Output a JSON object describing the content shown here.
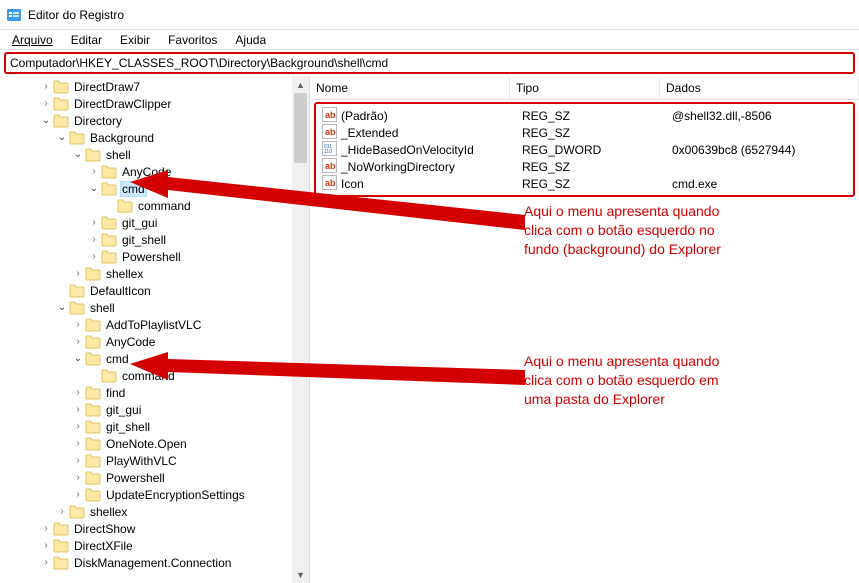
{
  "window": {
    "title": "Editor do Registro"
  },
  "menu": {
    "file": "Arquivo",
    "edit": "Editar",
    "view": "Exibir",
    "favorites": "Favoritos",
    "help": "Ajuda"
  },
  "address": {
    "path": "Computador\\HKEY_CLASSES_ROOT\\Directory\\Background\\shell\\cmd"
  },
  "columns": {
    "name": "Nome",
    "type": "Tipo",
    "data": "Dados"
  },
  "values": [
    {
      "name": "(Padrão)",
      "type": "REG_SZ",
      "data": "@shell32.dll,-8506",
      "kind": "str"
    },
    {
      "name": "_Extended",
      "type": "REG_SZ",
      "data": "",
      "kind": "str"
    },
    {
      "name": "_HideBasedOnVelocityId",
      "type": "REG_DWORD",
      "data": "0x00639bc8 (6527944)",
      "kind": "bin"
    },
    {
      "name": "_NoWorkingDirectory",
      "type": "REG_SZ",
      "data": "",
      "kind": "str"
    },
    {
      "name": "Icon",
      "type": "REG_SZ",
      "data": "cmd.exe",
      "kind": "str"
    }
  ],
  "tree": [
    {
      "lvl": 1,
      "twist": ">",
      "label": "DirectDraw7"
    },
    {
      "lvl": 1,
      "twist": ">",
      "label": "DirectDrawClipper"
    },
    {
      "lvl": 1,
      "twist": "v",
      "label": "Directory"
    },
    {
      "lvl": 2,
      "twist": "v",
      "label": "Background"
    },
    {
      "lvl": 3,
      "twist": "v",
      "label": "shell"
    },
    {
      "lvl": 4,
      "twist": ">",
      "label": "AnyCode"
    },
    {
      "lvl": 4,
      "twist": "v",
      "label": "cmd",
      "selected": true
    },
    {
      "lvl": 5,
      "twist": "",
      "label": "command"
    },
    {
      "lvl": 4,
      "twist": ">",
      "label": "git_gui"
    },
    {
      "lvl": 4,
      "twist": ">",
      "label": "git_shell"
    },
    {
      "lvl": 4,
      "twist": ">",
      "label": "Powershell"
    },
    {
      "lvl": 3,
      "twist": ">",
      "label": "shellex"
    },
    {
      "lvl": 2,
      "twist": "",
      "label": "DefaultIcon"
    },
    {
      "lvl": 2,
      "twist": "v",
      "label": "shell"
    },
    {
      "lvl": 3,
      "twist": ">",
      "label": "AddToPlaylistVLC"
    },
    {
      "lvl": 3,
      "twist": ">",
      "label": "AnyCode"
    },
    {
      "lvl": 3,
      "twist": "v",
      "label": "cmd"
    },
    {
      "lvl": 4,
      "twist": "",
      "label": "command"
    },
    {
      "lvl": 3,
      "twist": ">",
      "label": "find"
    },
    {
      "lvl": 3,
      "twist": ">",
      "label": "git_gui"
    },
    {
      "lvl": 3,
      "twist": ">",
      "label": "git_shell"
    },
    {
      "lvl": 3,
      "twist": ">",
      "label": "OneNote.Open"
    },
    {
      "lvl": 3,
      "twist": ">",
      "label": "PlayWithVLC"
    },
    {
      "lvl": 3,
      "twist": ">",
      "label": "Powershell"
    },
    {
      "lvl": 3,
      "twist": ">",
      "label": "UpdateEncryptionSettings"
    },
    {
      "lvl": 2,
      "twist": ">",
      "label": "shellex"
    },
    {
      "lvl": 1,
      "twist": ">",
      "label": "DirectShow"
    },
    {
      "lvl": 1,
      "twist": ">",
      "label": "DirectXFile"
    },
    {
      "lvl": 1,
      "twist": ">",
      "label": "DiskManagement.Connection"
    }
  ],
  "annotations": {
    "a1": "Aqui o menu apresenta quando\nclica com o botão esquerdo no\nfundo (background) do Explorer",
    "a2": "Aqui o menu apresenta quando\nclica com o botão esquerdo em\numa pasta do Explorer"
  }
}
